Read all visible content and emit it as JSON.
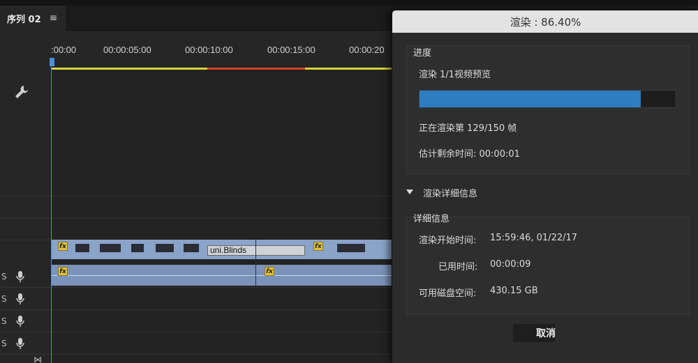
{
  "timeline": {
    "tab_label": "序列 02",
    "tab_menu_icon": "hamburger-icon",
    "ruler_labels": [
      ":00:00",
      "00:00:05:00",
      "00:00:10:00",
      "00:00:15:00",
      "00:00:20"
    ],
    "clip_effect_label": "uni.Blinds",
    "fx_badge": "fx",
    "track_label_letter": "S",
    "colors": {
      "playhead": "#4a90d9",
      "workarea_yellow": "#d9d23a",
      "workarea_red": "#d0442b",
      "clip_video": "#8aa3c9",
      "clip_audio": "#7c93b9"
    }
  },
  "dialog": {
    "title": "渲染 : 86.40%",
    "progress_group_title": "进度",
    "render_item": "渲染 1/1视频预览",
    "progress_fraction": 0.864,
    "frame_status": "正在渲染第 129/150 帧",
    "remaining_time": "估计剩余时间: 00:00:01",
    "details_toggle": "渲染详细信息",
    "details_group_title": "详细信息",
    "details": [
      {
        "label": "渲染开始时间:",
        "value": "15:59:46, 01/22/17"
      },
      {
        "label": "已用时间:",
        "value": "00:00:09"
      },
      {
        "label": "可用磁盘空间:",
        "value": "430.15 GB"
      }
    ],
    "cancel_label": "取消",
    "colors": {
      "progress_fill": "#2d7dc0",
      "title_bar": "#e3e3e3"
    }
  }
}
